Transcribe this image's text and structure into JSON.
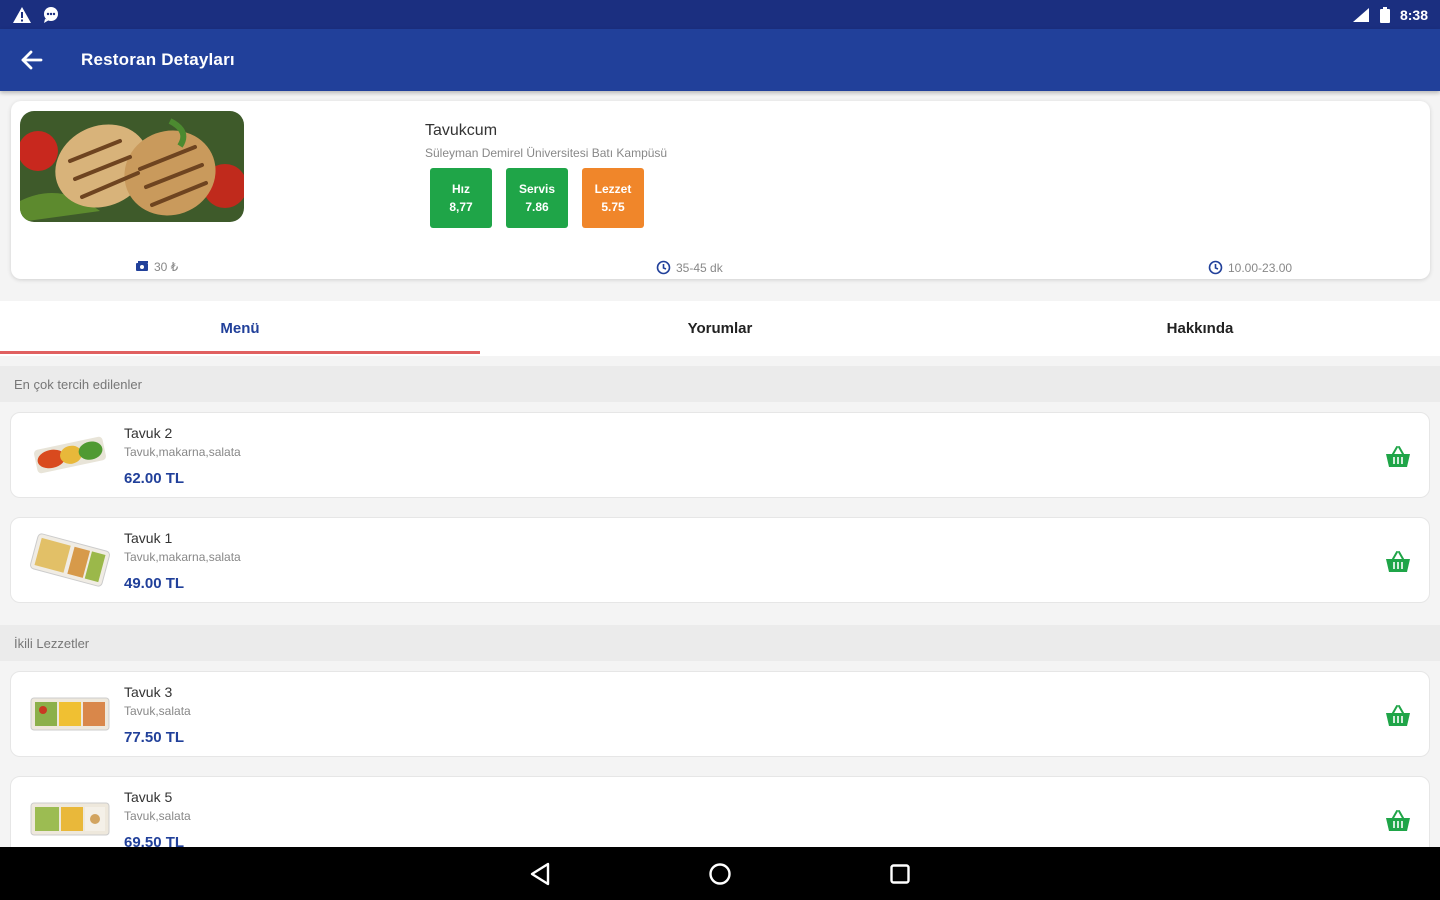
{
  "status_bar": {
    "time": "8:38"
  },
  "app_bar": {
    "title": "Restoran Detayları"
  },
  "restaurant": {
    "name": "Tavukcum",
    "address": "Süleyman Demirel Üniversitesi Batı Kampüsü",
    "ratings": [
      {
        "label": "Hız",
        "value": "8,77",
        "color": "#1fa548"
      },
      {
        "label": "Servis",
        "value": "7.86",
        "color": "#1fa548"
      },
      {
        "label": "Lezzet",
        "value": "5.75",
        "color": "#f0862a"
      }
    ],
    "min_order": "30 ₺",
    "delivery_time": "35-45 dk",
    "hours": "10.00-23.00"
  },
  "tabs": [
    {
      "label": "Menü",
      "active": true
    },
    {
      "label": "Yorumlar",
      "active": false
    },
    {
      "label": "Hakkında",
      "active": false
    }
  ],
  "sections": [
    {
      "title": "En çok tercih edilenler",
      "items": [
        {
          "name": "Tavuk 2",
          "desc": "Tavuk,makarna,salata",
          "price": "62.00 TL"
        },
        {
          "name": "Tavuk 1",
          "desc": "Tavuk,makarna,salata",
          "price": "49.00 TL"
        }
      ]
    },
    {
      "title": "İkili Lezzetler",
      "items": [
        {
          "name": "Tavuk 3",
          "desc": "Tavuk,salata",
          "price": "77.50 TL"
        },
        {
          "name": "Tavuk 5",
          "desc": "Tavuk,salata",
          "price": "69.50 TL"
        }
      ]
    }
  ],
  "colors": {
    "primary": "#21409a",
    "status_bar": "#1b2f80",
    "green": "#1fa548",
    "orange": "#f0862a",
    "tab_indicator": "#e06060"
  }
}
